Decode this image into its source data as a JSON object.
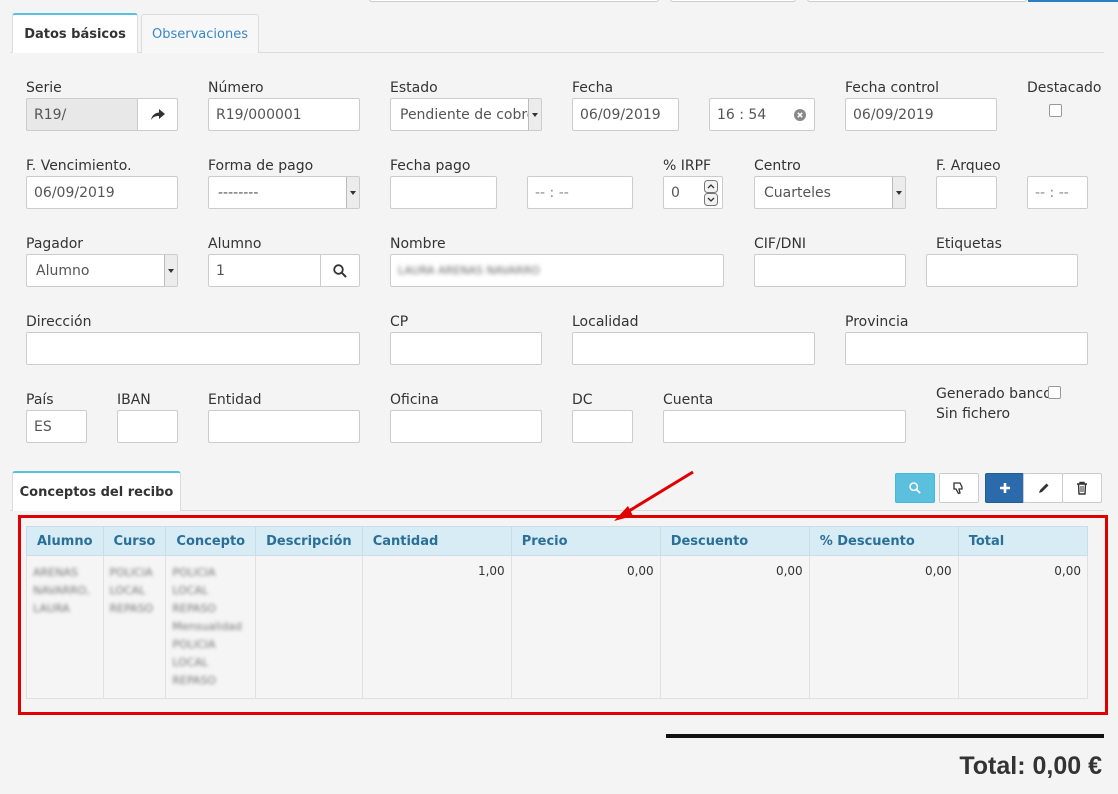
{
  "tabs": {
    "basic": "Datos básicos",
    "obs": "Observaciones"
  },
  "form": {
    "serie": {
      "label": "Serie",
      "value": "R19/"
    },
    "numero": {
      "label": "Número",
      "value": "R19/000001"
    },
    "estado": {
      "label": "Estado",
      "value": "Pendiente de cobro"
    },
    "fecha": {
      "label": "Fecha",
      "value": "06/09/2019",
      "time": "16 : 54"
    },
    "fecha_control": {
      "label": "Fecha control",
      "value": "06/09/2019"
    },
    "destacado": {
      "label": "Destacado"
    },
    "vencimiento": {
      "label": "F. Vencimiento.",
      "value": "06/09/2019"
    },
    "forma_pago": {
      "label": "Forma de pago",
      "value": "--------"
    },
    "fecha_pago": {
      "label": "Fecha pago",
      "time_placeholder": "-- : --"
    },
    "irpf": {
      "label": "% IRPF",
      "value": "0"
    },
    "centro": {
      "label": "Centro",
      "value": "Cuarteles"
    },
    "arqueo": {
      "label": "F. Arqueo",
      "time_placeholder": "-- : --"
    },
    "pagador": {
      "label": "Pagador",
      "value": "Alumno"
    },
    "alumno": {
      "label": "Alumno",
      "value": "1"
    },
    "nombre": {
      "label": "Nombre",
      "value": "LAURA ARENAS NAVARRO"
    },
    "cif": {
      "label": "CIF/DNI"
    },
    "etiquetas": {
      "label": "Etiquetas"
    },
    "direccion": {
      "label": "Dirección"
    },
    "cp": {
      "label": "CP"
    },
    "localidad": {
      "label": "Localidad"
    },
    "provincia": {
      "label": "Provincia"
    },
    "pais": {
      "label": "País",
      "value": "ES"
    },
    "iban": {
      "label": "IBAN"
    },
    "entidad": {
      "label": "Entidad"
    },
    "oficina": {
      "label": "Oficina"
    },
    "dc": {
      "label": "DC"
    },
    "cuenta": {
      "label": "Cuenta"
    },
    "generado": {
      "label1": "Generado banco",
      "label2": "Sin fichero"
    }
  },
  "conceptos": {
    "tab": "Conceptos del recibo",
    "columns": [
      "Alumno",
      "Curso",
      "Concepto",
      "Descripción",
      "Cantidad",
      "Precio",
      "Descuento",
      "% Descuento",
      "Total"
    ],
    "row": {
      "alumno": "ARENAS NAVARRO, LAURA",
      "curso": "POLICIA LOCAL REPASO",
      "concepto": "POLICIA LOCAL REPASO Mensualidad POLICIA LOCAL REPASO",
      "descripcion": "",
      "cantidad": "1,00",
      "precio": "0,00",
      "descuento": "0,00",
      "pct_descuento": "0,00",
      "total": "0,00"
    }
  },
  "total_text": "Total: 0,00 €",
  "colors": {
    "accent": "#5bc0de",
    "primary": "#2b6bab",
    "highlight": "#e00000"
  }
}
